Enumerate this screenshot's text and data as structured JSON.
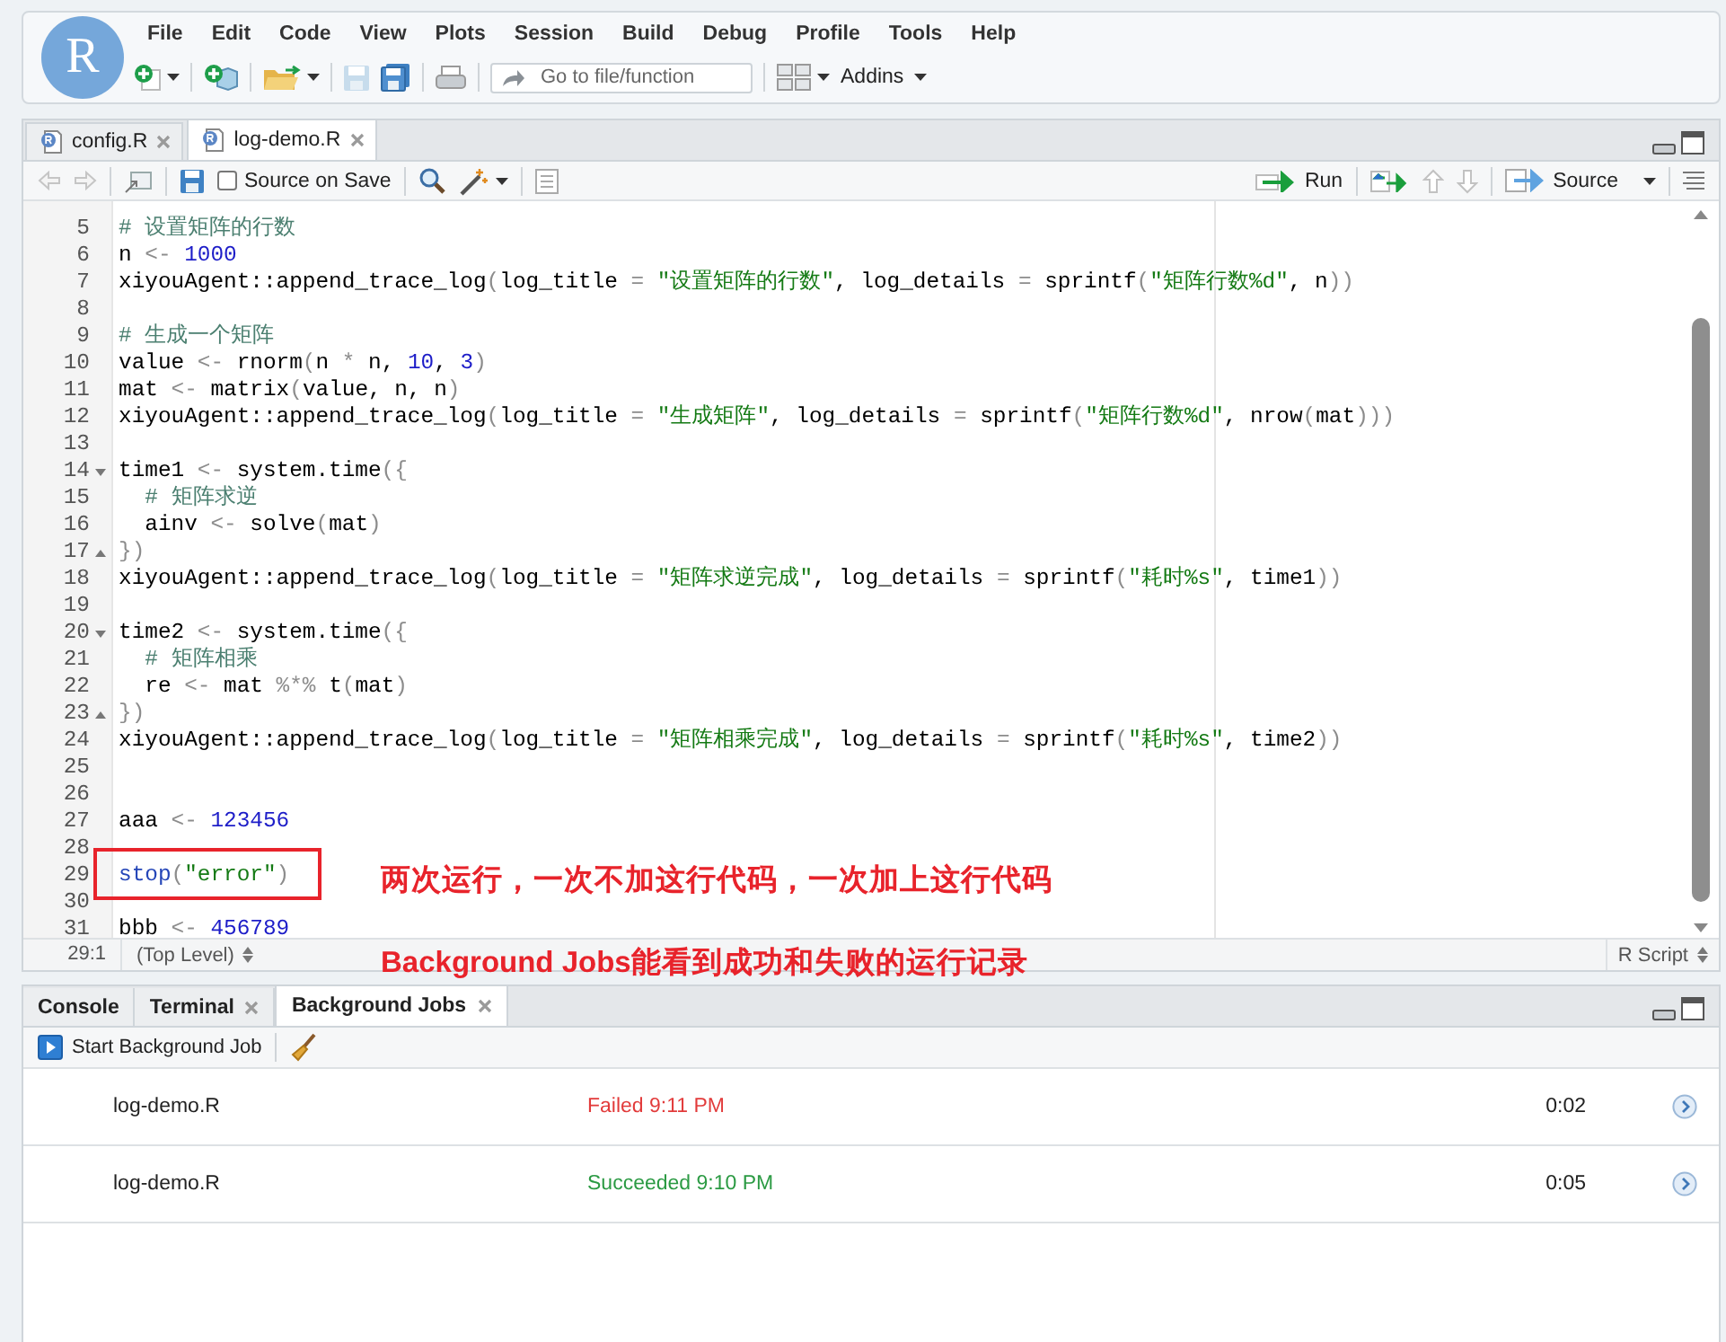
{
  "app": {
    "logo": "R",
    "menu": [
      "File",
      "Edit",
      "Code",
      "View",
      "Plots",
      "Session",
      "Build",
      "Debug",
      "Profile",
      "Tools",
      "Help"
    ],
    "goto": {
      "placeholder": "Go to file/function"
    },
    "addins": "Addins"
  },
  "editor": {
    "tabs": [
      {
        "label": "config.R",
        "selected": false
      },
      {
        "label": "log-demo.R",
        "selected": true
      }
    ],
    "source_on_save": {
      "label": "Source on Save",
      "checked": false
    },
    "run_label": "Run",
    "source_label": "Source",
    "lines": [
      {
        "n": "5",
        "kind": "code",
        "boxed": false,
        "tokens": [
          {
            "text": "# 设置矩阵的行数",
            "kind": "comment"
          }
        ]
      },
      {
        "n": "6",
        "kind": "code",
        "boxed": false,
        "tokens": [
          {
            "text": "n ",
            "kind": "plain"
          },
          {
            "text": "<- ",
            "kind": "punct"
          },
          {
            "text": "1000",
            "kind": "number"
          }
        ]
      },
      {
        "n": "7",
        "kind": "code",
        "boxed": false,
        "tokens": [
          {
            "text": "xiyouAgent::append_trace_log",
            "kind": "plain"
          },
          {
            "text": "(",
            "kind": "punct"
          },
          {
            "text": "log_title ",
            "kind": "plain"
          },
          {
            "text": "= ",
            "kind": "punct"
          },
          {
            "text": "\"设置矩阵的行数\"",
            "kind": "string"
          },
          {
            "text": ", log_details ",
            "kind": "plain"
          },
          {
            "text": "=",
            "kind": "punct"
          },
          {
            "text": " sprintf",
            "kind": "plain"
          },
          {
            "text": "(",
            "kind": "punct"
          },
          {
            "text": "\"矩阵行数%d\"",
            "kind": "string"
          },
          {
            "text": ", n",
            "kind": "plain"
          },
          {
            "text": "))",
            "kind": "punct"
          }
        ]
      },
      {
        "n": "8",
        "kind": "code",
        "boxed": false
      },
      {
        "n": "9",
        "kind": "code",
        "boxed": false,
        "tokens": [
          {
            "text": "# 生成一个矩阵",
            "kind": "comment"
          }
        ]
      },
      {
        "n": "10",
        "kind": "code",
        "boxed": false,
        "tokens": [
          {
            "text": "value ",
            "kind": "plain"
          },
          {
            "text": "<-",
            "kind": "punct"
          },
          {
            "text": " rnorm",
            "kind": "plain"
          },
          {
            "text": "(",
            "kind": "punct"
          },
          {
            "text": "n ",
            "kind": "plain"
          },
          {
            "text": "*",
            "kind": "punct"
          },
          {
            "text": " n, ",
            "kind": "plain"
          },
          {
            "text": "10",
            "kind": "number"
          },
          {
            "text": ", ",
            "kind": "plain"
          },
          {
            "text": "3",
            "kind": "number"
          },
          {
            "text": ")",
            "kind": "punct"
          }
        ]
      },
      {
        "n": "11",
        "kind": "code",
        "boxed": false,
        "tokens": [
          {
            "text": "mat ",
            "kind": "plain"
          },
          {
            "text": "<-",
            "kind": "punct"
          },
          {
            "text": " matrix",
            "kind": "plain"
          },
          {
            "text": "(",
            "kind": "punct"
          },
          {
            "text": "value, n, n",
            "kind": "plain"
          },
          {
            "text": ")",
            "kind": "punct"
          }
        ]
      },
      {
        "n": "12",
        "kind": "code",
        "boxed": false,
        "tokens": [
          {
            "text": "xiyouAgent::append_trace_log",
            "kind": "plain"
          },
          {
            "text": "(",
            "kind": "punct"
          },
          {
            "text": "log_title ",
            "kind": "plain"
          },
          {
            "text": "= ",
            "kind": "punct"
          },
          {
            "text": "\"生成矩阵\"",
            "kind": "string"
          },
          {
            "text": ", log_details ",
            "kind": "plain"
          },
          {
            "text": "=",
            "kind": "punct"
          },
          {
            "text": " sprintf",
            "kind": "plain"
          },
          {
            "text": "(",
            "kind": "punct"
          },
          {
            "text": "\"矩阵行数%d\"",
            "kind": "string"
          },
          {
            "text": ", nrow",
            "kind": "plain"
          },
          {
            "text": "(",
            "kind": "punct"
          },
          {
            "text": "mat",
            "kind": "plain"
          },
          {
            "text": ")))",
            "kind": "punct"
          }
        ]
      },
      {
        "n": "13",
        "kind": "code",
        "boxed": false
      },
      {
        "n": "14",
        "kind": "fold-start",
        "boxed": false,
        "tokens": [
          {
            "text": "time1 ",
            "kind": "plain"
          },
          {
            "text": "<-",
            "kind": "punct"
          },
          {
            "text": " system.time",
            "kind": "plain"
          },
          {
            "text": "({",
            "kind": "punct"
          }
        ]
      },
      {
        "n": "15",
        "kind": "code",
        "boxed": false,
        "tokens": [
          {
            "text": "  # 矩阵求逆",
            "kind": "comment"
          }
        ]
      },
      {
        "n": "16",
        "kind": "code",
        "boxed": false,
        "tokens": [
          {
            "text": "  ainv ",
            "kind": "plain"
          },
          {
            "text": "<-",
            "kind": "punct"
          },
          {
            "text": " solve",
            "kind": "plain"
          },
          {
            "text": "(",
            "kind": "punct"
          },
          {
            "text": "mat",
            "kind": "plain"
          },
          {
            "text": ")",
            "kind": "punct"
          }
        ]
      },
      {
        "n": "17",
        "kind": "fold-end",
        "boxed": false,
        "tokens": [
          {
            "text": "})",
            "kind": "punct"
          }
        ]
      },
      {
        "n": "18",
        "kind": "code",
        "boxed": false,
        "tokens": [
          {
            "text": "xiyouAgent::append_trace_log",
            "kind": "plain"
          },
          {
            "text": "(",
            "kind": "punct"
          },
          {
            "text": "log_title ",
            "kind": "plain"
          },
          {
            "text": "= ",
            "kind": "punct"
          },
          {
            "text": "\"矩阵求逆完成\"",
            "kind": "string"
          },
          {
            "text": ", log_details ",
            "kind": "plain"
          },
          {
            "text": "=",
            "kind": "punct"
          },
          {
            "text": " sprintf",
            "kind": "plain"
          },
          {
            "text": "(",
            "kind": "punct"
          },
          {
            "text": "\"耗时%s\"",
            "kind": "string"
          },
          {
            "text": ", time1",
            "kind": "plain"
          },
          {
            "text": "))",
            "kind": "punct"
          }
        ]
      },
      {
        "n": "19",
        "kind": "code",
        "boxed": false
      },
      {
        "n": "20",
        "kind": "fold-start",
        "boxed": false,
        "tokens": [
          {
            "text": "time2 ",
            "kind": "plain"
          },
          {
            "text": "<-",
            "kind": "punct"
          },
          {
            "text": " system.time",
            "kind": "plain"
          },
          {
            "text": "({",
            "kind": "punct"
          }
        ]
      },
      {
        "n": "21",
        "kind": "code",
        "boxed": false,
        "tokens": [
          {
            "text": "  # 矩阵相乘",
            "kind": "comment"
          }
        ]
      },
      {
        "n": "22",
        "kind": "code",
        "boxed": false,
        "tokens": [
          {
            "text": "  re ",
            "kind": "plain"
          },
          {
            "text": "<-",
            "kind": "punct"
          },
          {
            "text": " mat ",
            "kind": "plain"
          },
          {
            "text": "%*%",
            "kind": "punct"
          },
          {
            "text": " t",
            "kind": "plain"
          },
          {
            "text": "(",
            "kind": "punct"
          },
          {
            "text": "mat",
            "kind": "plain"
          },
          {
            "text": ")",
            "kind": "punct"
          }
        ]
      },
      {
        "n": "23",
        "kind": "fold-end",
        "boxed": false,
        "tokens": [
          {
            "text": "})",
            "kind": "punct"
          }
        ]
      },
      {
        "n": "24",
        "kind": "code",
        "boxed": false,
        "tokens": [
          {
            "text": "xiyouAgent::append_trace_log",
            "kind": "plain"
          },
          {
            "text": "(",
            "kind": "punct"
          },
          {
            "text": "log_title ",
            "kind": "plain"
          },
          {
            "text": "= ",
            "kind": "punct"
          },
          {
            "text": "\"矩阵相乘完成\"",
            "kind": "string"
          },
          {
            "text": ", log_details ",
            "kind": "plain"
          },
          {
            "text": "=",
            "kind": "punct"
          },
          {
            "text": " sprintf",
            "kind": "plain"
          },
          {
            "text": "(",
            "kind": "punct"
          },
          {
            "text": "\"耗时%s\"",
            "kind": "string"
          },
          {
            "text": ", time2",
            "kind": "plain"
          },
          {
            "text": "))",
            "kind": "punct"
          }
        ]
      },
      {
        "n": "25",
        "kind": "code",
        "boxed": false
      },
      {
        "n": "26",
        "kind": "code",
        "boxed": false
      },
      {
        "n": "27",
        "kind": "code",
        "boxed": false,
        "tokens": [
          {
            "text": "aaa ",
            "kind": "plain"
          },
          {
            "text": "<- ",
            "kind": "punct"
          },
          {
            "text": "123456",
            "kind": "number"
          }
        ]
      },
      {
        "n": "28",
        "kind": "code",
        "boxed": false
      },
      {
        "n": "29",
        "kind": "code",
        "boxed": true,
        "tokens": [
          {
            "text": "stop",
            "kind": "func"
          },
          {
            "text": "(",
            "kind": "punct"
          },
          {
            "text": "\"error\"",
            "kind": "string"
          },
          {
            "text": ")",
            "kind": "punct"
          }
        ]
      },
      {
        "n": "30",
        "kind": "code",
        "boxed": false
      },
      {
        "n": "31",
        "kind": "code",
        "boxed": false,
        "tokens": [
          {
            "text": "bbb ",
            "kind": "plain"
          },
          {
            "text": "<- ",
            "kind": "punct"
          },
          {
            "text": "456789",
            "kind": "number"
          }
        ]
      }
    ],
    "status": {
      "position": "29:1",
      "scope": "(Top Level)",
      "file_type": "R Script"
    }
  },
  "jobs_pane": {
    "tabs": [
      {
        "label": "Console",
        "selected": false,
        "closable": false
      },
      {
        "label": "Terminal",
        "selected": false,
        "closable": true
      },
      {
        "label": "Background Jobs",
        "selected": true,
        "closable": true
      }
    ],
    "start_button": "Start Background Job",
    "jobs": [
      {
        "name": "log-demo.R",
        "kind": "failed",
        "status": "Failed 9:11 PM",
        "duration": "0:02"
      },
      {
        "name": "log-demo.R",
        "kind": "succeeded",
        "status": "Succeeded 9:10 PM",
        "duration": "0:05"
      }
    ]
  },
  "annotations": [
    "两次运行，一次不加这行代码，一次加上这行代码",
    "Background Jobs能看到成功和失败的运行记录"
  ]
}
